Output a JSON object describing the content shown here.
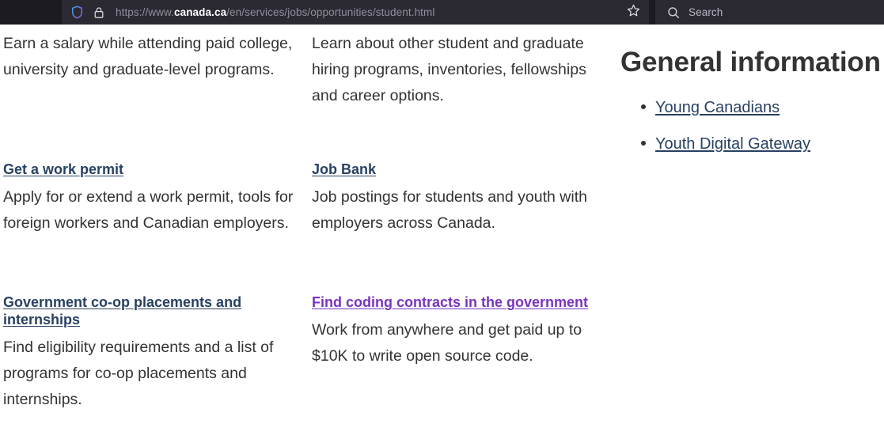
{
  "browser": {
    "shield_icon": "shield-icon",
    "lock_icon": "lock-icon",
    "url_prefix": "https://www.",
    "url_domain": "canada.ca",
    "url_path": "/en/services/jobs/opportunities/student.html",
    "url_full": "https://www.canada.ca/en/services/jobs/opportunities/student.html",
    "bookmark_icon": "star-icon",
    "search_icon": "search-icon",
    "search_placeholder": "Search",
    "colors": {
      "toolbar_bg": "#1c1b22",
      "field_bg": "#2b2a33",
      "url_text": "#8f8f9d",
      "domain_text": "#ffffff"
    }
  },
  "page": {
    "colors": {
      "link": "#284162",
      "link_visited": "#7834bc",
      "body_text": "#333333"
    },
    "column_one": {
      "lead_text": "Earn a salary while attending paid college, university and graduate-level programs.",
      "cards": [
        {
          "link": "Get a work permit",
          "description": "Apply for or extend a work permit, tools for foreign workers and Canadian employers.",
          "visited": false
        },
        {
          "link": "Government co-op placements and internships",
          "description": "Find eligibility requirements and a list of programs for co-op placements and internships.",
          "visited": false
        }
      ]
    },
    "column_two": {
      "lead_text": "Learn about other student and graduate hiring programs, inventories, fellowships and career options.",
      "cards": [
        {
          "link": "Job Bank",
          "description": "Job postings for students and youth with employers across Canada.",
          "visited": false
        },
        {
          "link": "Find coding contracts in the government",
          "description": "Work from anywhere and get paid up to $10K to write open source code.",
          "visited": true
        }
      ]
    },
    "sidebar": {
      "heading": "General information",
      "links": [
        "Young Canadians",
        "Youth Digital Gateway"
      ]
    }
  }
}
